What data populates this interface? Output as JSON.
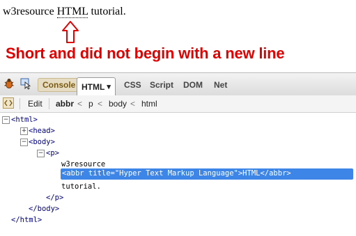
{
  "page": {
    "text_before": "w3resource ",
    "abbr": "HTML",
    "text_after": " tutorial."
  },
  "annotation": "Short and did not begin with a new line",
  "annotation_color": "#e00000",
  "toolbar": {
    "tabs": [
      "Console",
      "HTML",
      "CSS",
      "Script",
      "DOM",
      "Net"
    ],
    "html_dropdown_arrow": "▾"
  },
  "breadcrumb": {
    "edit": "Edit",
    "items": [
      "abbr",
      "p",
      "body",
      "html"
    ],
    "separator": "<"
  },
  "tree": {
    "html_open": "<html>",
    "head": "<head>",
    "body_open": "<body>",
    "p_open": "<p>",
    "text1": "w3resource",
    "selected": "<abbr title=\"Hyper Text Markup Language\">HTML</abbr>",
    "text2": "tutorial.",
    "p_close": "</p>",
    "body_close": "</body>",
    "html_close": "</html>"
  },
  "colors": {
    "selection": "#3d85e6",
    "tag": "#000080"
  }
}
